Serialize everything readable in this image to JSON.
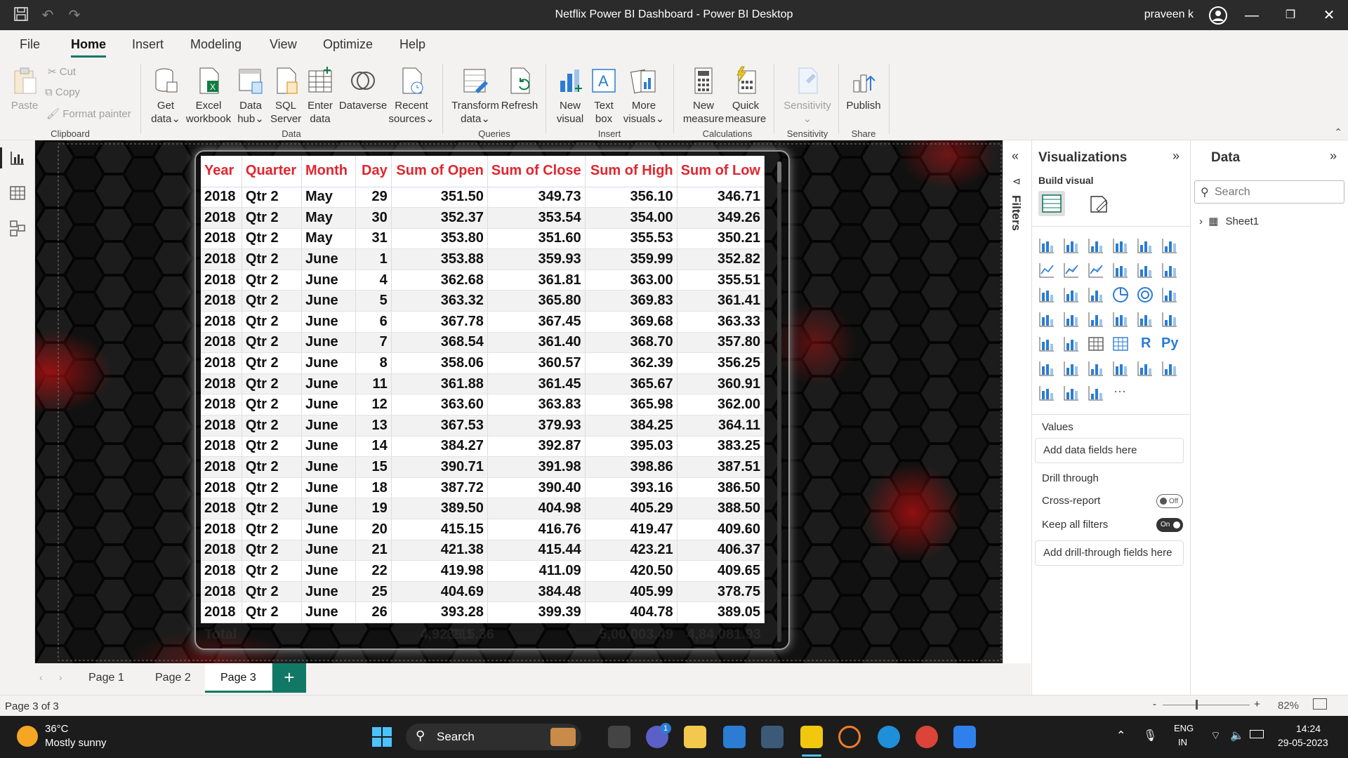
{
  "window": {
    "title": "Netflix Power BI Dashboard - Power BI Desktop",
    "user": "praveen k"
  },
  "menu": [
    "File",
    "Home",
    "Insert",
    "Modeling",
    "View",
    "Optimize",
    "Help"
  ],
  "ribbon": {
    "clipboard": {
      "paste": "Paste",
      "cut": "Cut",
      "copy": "Copy",
      "format_painter": "Format painter",
      "group": "Clipboard"
    },
    "data": {
      "get_data": [
        "Get",
        "data"
      ],
      "excel": [
        "Excel",
        "workbook"
      ],
      "data_hub": [
        "Data",
        "hub"
      ],
      "sql": [
        "SQL",
        "Server"
      ],
      "enter": [
        "Enter",
        "data"
      ],
      "dataverse": "Dataverse",
      "recent": [
        "Recent",
        "sources"
      ],
      "group": "Data"
    },
    "queries": {
      "transform": [
        "Transform",
        "data"
      ],
      "refresh": "Refresh",
      "group": "Queries"
    },
    "insert": {
      "new_visual": [
        "New",
        "visual"
      ],
      "text_box": [
        "Text",
        "box"
      ],
      "more_visuals": [
        "More",
        "visuals"
      ],
      "group": "Insert"
    },
    "calculations": {
      "new_measure": [
        "New",
        "measure"
      ],
      "quick_measure": [
        "Quick",
        "measure"
      ],
      "group": "Calculations"
    },
    "sensitivity": {
      "label": "Sensitivity",
      "group": "Sensitivity"
    },
    "share": {
      "publish": "Publish",
      "group": "Share"
    }
  },
  "table": {
    "columns": [
      "Year",
      "Quarter",
      "Month",
      "Day",
      "Sum of Open",
      "Sum of Close",
      "Sum of High",
      "Sum of Low"
    ],
    "rows": [
      [
        "2018",
        "Qtr 2",
        "May",
        "29",
        "351.50",
        "349.73",
        "356.10",
        "346.71"
      ],
      [
        "2018",
        "Qtr 2",
        "May",
        "30",
        "352.37",
        "353.54",
        "354.00",
        "349.26"
      ],
      [
        "2018",
        "Qtr 2",
        "May",
        "31",
        "353.80",
        "351.60",
        "355.53",
        "350.21"
      ],
      [
        "2018",
        "Qtr 2",
        "June",
        "1",
        "353.88",
        "359.93",
        "359.99",
        "352.82"
      ],
      [
        "2018",
        "Qtr 2",
        "June",
        "4",
        "362.68",
        "361.81",
        "363.00",
        "355.51"
      ],
      [
        "2018",
        "Qtr 2",
        "June",
        "5",
        "363.32",
        "365.80",
        "369.83",
        "361.41"
      ],
      [
        "2018",
        "Qtr 2",
        "June",
        "6",
        "367.78",
        "367.45",
        "369.68",
        "363.33"
      ],
      [
        "2018",
        "Qtr 2",
        "June",
        "7",
        "368.54",
        "361.40",
        "368.70",
        "357.80"
      ],
      [
        "2018",
        "Qtr 2",
        "June",
        "8",
        "358.06",
        "360.57",
        "362.39",
        "356.25"
      ],
      [
        "2018",
        "Qtr 2",
        "June",
        "11",
        "361.88",
        "361.45",
        "365.67",
        "360.91"
      ],
      [
        "2018",
        "Qtr 2",
        "June",
        "12",
        "363.60",
        "363.83",
        "365.98",
        "362.00"
      ],
      [
        "2018",
        "Qtr 2",
        "June",
        "13",
        "367.53",
        "379.93",
        "384.25",
        "364.11"
      ],
      [
        "2018",
        "Qtr 2",
        "June",
        "14",
        "384.27",
        "392.87",
        "395.03",
        "383.25"
      ],
      [
        "2018",
        "Qtr 2",
        "June",
        "15",
        "390.71",
        "391.98",
        "398.86",
        "387.51"
      ],
      [
        "2018",
        "Qtr 2",
        "June",
        "18",
        "387.72",
        "390.40",
        "393.16",
        "386.50"
      ],
      [
        "2018",
        "Qtr 2",
        "June",
        "19",
        "389.50",
        "404.98",
        "405.29",
        "388.50"
      ],
      [
        "2018",
        "Qtr 2",
        "June",
        "20",
        "415.15",
        "416.76",
        "419.47",
        "409.60"
      ],
      [
        "2018",
        "Qtr 2",
        "June",
        "21",
        "421.38",
        "415.44",
        "423.21",
        "406.37"
      ],
      [
        "2018",
        "Qtr 2",
        "June",
        "22",
        "419.98",
        "411.09",
        "420.50",
        "409.65"
      ],
      [
        "2018",
        "Qtr 2",
        "June",
        "25",
        "404.69",
        "384.48",
        "405.99",
        "378.75"
      ],
      [
        "2018",
        "Qtr 2",
        "June",
        "26",
        "393.28",
        "399.39",
        "404.78",
        "389.05"
      ]
    ],
    "total_label": "Total",
    "totals": [
      "89,1",
      "4,92,215.36",
      "5,00,003.49",
      "4,84,081.93"
    ]
  },
  "filters_label": "Filters",
  "visualizations": {
    "title": "Visualizations",
    "build_visual": "Build visual",
    "values": "Values",
    "add_data_fields": "Add data fields here",
    "drill_through": "Drill through",
    "cross_report": "Cross-report",
    "cross_report_state": "Off",
    "keep_all_filters": "Keep all filters",
    "keep_state": "On",
    "add_drill": "Add drill-through fields here",
    "r_label": "R",
    "py_label": "Py"
  },
  "data_pane": {
    "title": "Data",
    "search_placeholder": "Search",
    "table": "Sheet1"
  },
  "pages": [
    "Page 1",
    "Page 2",
    "Page 3"
  ],
  "status": {
    "page_info": "Page 3 of 3",
    "zoom": "82%"
  },
  "taskbar": {
    "temp": "36°C",
    "weather": "Mostly sunny",
    "search": "Search",
    "lang1": "ENG",
    "lang2": "IN",
    "time": "14:24",
    "date": "29-05-2023",
    "chat_badge": "1"
  }
}
